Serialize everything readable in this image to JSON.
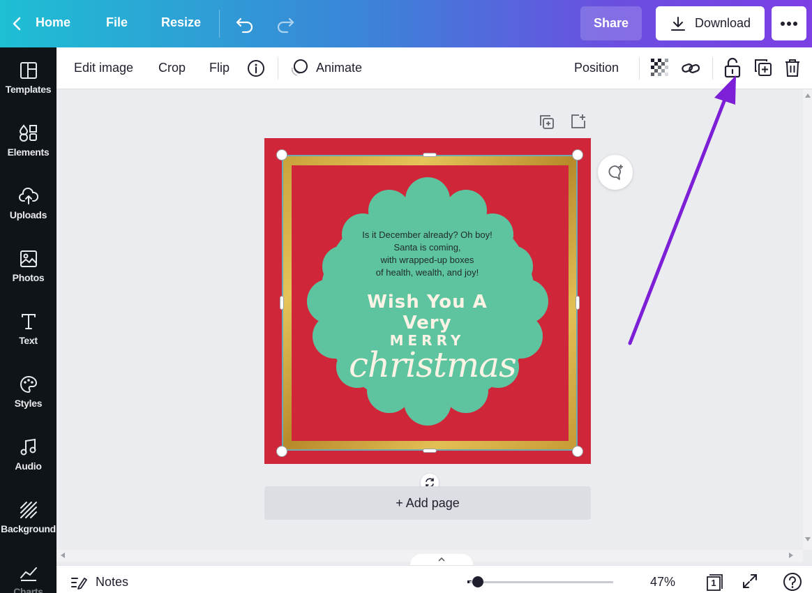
{
  "topbar": {
    "home": "Home",
    "file": "File",
    "resize": "Resize",
    "share": "Share",
    "download": "Download"
  },
  "sidebar": {
    "items": [
      {
        "label": "Templates",
        "icon": "templates-icon"
      },
      {
        "label": "Elements",
        "icon": "elements-icon"
      },
      {
        "label": "Uploads",
        "icon": "uploads-icon"
      },
      {
        "label": "Photos",
        "icon": "photos-icon"
      },
      {
        "label": "Text",
        "icon": "text-icon"
      },
      {
        "label": "Styles",
        "icon": "styles-icon"
      },
      {
        "label": "Audio",
        "icon": "audio-icon"
      },
      {
        "label": "Background",
        "icon": "background-icon"
      },
      {
        "label": "Charts",
        "icon": "charts-icon"
      }
    ]
  },
  "toolbar": {
    "edit_image": "Edit image",
    "crop": "Crop",
    "flip": "Flip",
    "animate": "Animate",
    "position": "Position"
  },
  "card": {
    "poem_lines": [
      "Is it December already? Oh boy!",
      "Santa is coming,",
      "with wrapped-up boxes",
      "of health, wealth, and joy!"
    ],
    "wish": "Wish You A Very",
    "merry": "MERRY",
    "christmas": "christmas"
  },
  "canvas": {
    "add_page": "+ Add page"
  },
  "bottombar": {
    "notes": "Notes",
    "zoom": "47%",
    "zoom_level": 0.47,
    "page_count": "1"
  },
  "colors": {
    "accent_gradient_start": "#1ebfd3",
    "accent_gradient_end": "#7b3fe4",
    "card_red": "#cf2739",
    "card_mint": "#5ec4a0",
    "annotation_arrow": "#7d1fd6"
  }
}
